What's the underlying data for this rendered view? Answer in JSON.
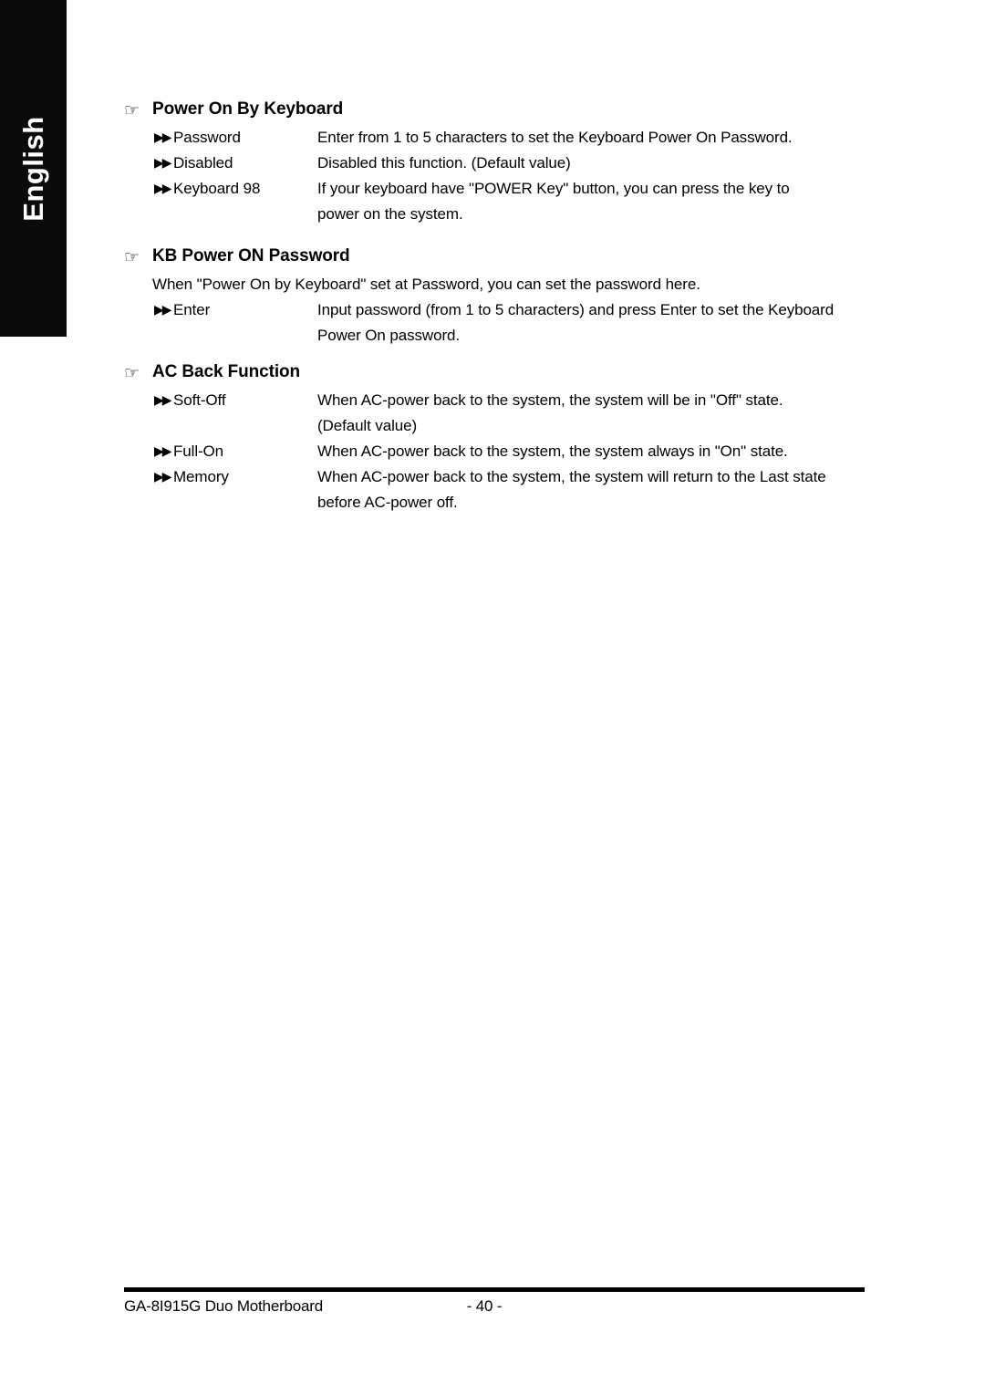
{
  "language_tab": {
    "label": "English"
  },
  "icons": {
    "hand": "☞",
    "bullet": "▶▶"
  },
  "sections": [
    {
      "title": "Power On By Keyboard",
      "options": [
        {
          "term": "Password",
          "desc": "Enter from 1 to 5 characters to set the Keyboard Power On Password.",
          "cont": ""
        },
        {
          "term": "Disabled",
          "desc": "Disabled this function. (Default value)",
          "cont": ""
        },
        {
          "term": "Keyboard 98",
          "desc": "If your keyboard have \"POWER Key\" button, you can press the key to",
          "cont": "power on the system."
        }
      ]
    },
    {
      "title": "KB Power ON Password",
      "intro": "When \"Power On by Keyboard\" set at Password, you can set the password here.",
      "options": [
        {
          "term": "Enter",
          "desc": "Input password (from 1 to 5 characters) and press Enter to set the Keyboard",
          "cont": "Power On password."
        }
      ]
    },
    {
      "title": "AC Back Function",
      "options": [
        {
          "term": "Soft-Off",
          "desc": "When AC-power back to the system, the system will be in \"Off\" state.",
          "cont": "(Default value)"
        },
        {
          "term": "Full-On",
          "desc": "When AC-power back to the system, the system always in \"On\" state.",
          "cont": ""
        },
        {
          "term": "Memory",
          "desc": "When AC-power back to the system, the system will return to the Last state",
          "cont": "before AC-power off."
        }
      ]
    }
  ],
  "footer": {
    "title": "GA-8I915G Duo Motherboard",
    "page": "- 40 -"
  }
}
